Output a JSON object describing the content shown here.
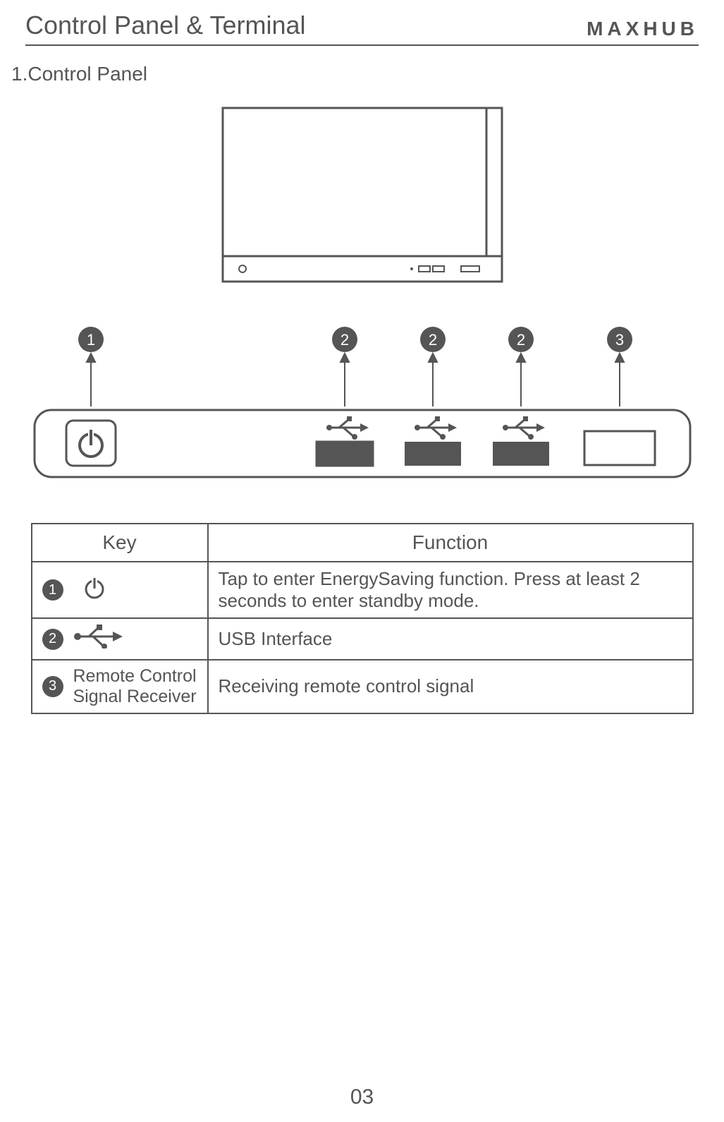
{
  "header": {
    "title": "Control Panel & Terminal",
    "brand": "MAXHUB"
  },
  "section": {
    "title": "1.Control Panel"
  },
  "diagram": {
    "callouts": [
      "1",
      "2",
      "2",
      "2",
      "3"
    ]
  },
  "table": {
    "headers": {
      "key": "Key",
      "function": "Function"
    },
    "rows": [
      {
        "badge": "1",
        "key_icon": "power",
        "key_text": "",
        "function": "Tap to enter EnergySaving function. Press at least 2 seconds to enter standby mode."
      },
      {
        "badge": "2",
        "key_icon": "usb",
        "key_text": "",
        "function": "USB Interface"
      },
      {
        "badge": "3",
        "key_icon": "",
        "key_text": "Remote Control Signal Receiver",
        "function": "Receiving remote control signal"
      }
    ]
  },
  "page_number": "03"
}
